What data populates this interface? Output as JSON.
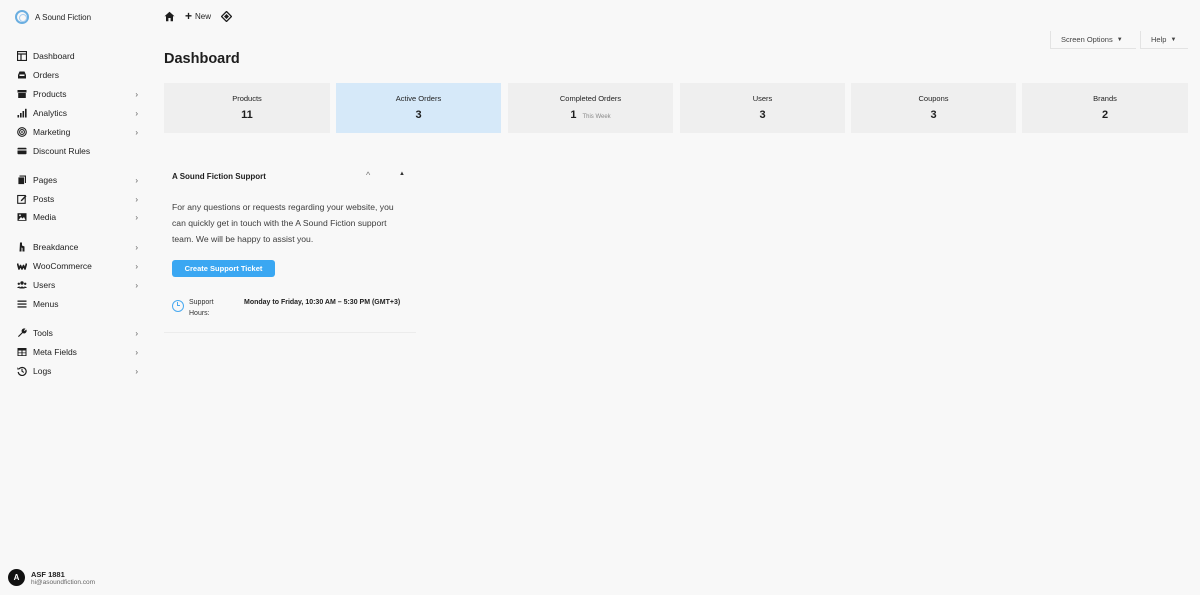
{
  "brand": {
    "name": "A Sound Fiction"
  },
  "sidebar": {
    "items": [
      {
        "label": "Dashboard",
        "icon": "dashboard-icon",
        "has_children": false
      },
      {
        "label": "Orders",
        "icon": "inbox-icon",
        "has_children": false
      },
      {
        "label": "Products",
        "icon": "archive-icon",
        "has_children": true
      },
      {
        "label": "Analytics",
        "icon": "bar-chart-icon",
        "has_children": true
      },
      {
        "label": "Marketing",
        "icon": "target-icon",
        "has_children": true
      },
      {
        "label": "Discount Rules",
        "icon": "credit-card-icon",
        "has_children": false
      },
      {
        "label": "Pages",
        "icon": "pages-icon",
        "has_children": true
      },
      {
        "label": "Posts",
        "icon": "edit-icon",
        "has_children": true
      },
      {
        "label": "Media",
        "icon": "image-icon",
        "has_children": true
      },
      {
        "label": "Breakdance",
        "icon": "breakdance-icon",
        "has_children": true
      },
      {
        "label": "WooCommerce",
        "icon": "woocommerce-icon",
        "has_children": true
      },
      {
        "label": "Users",
        "icon": "users-icon",
        "has_children": true
      },
      {
        "label": "Menus",
        "icon": "menu-icon",
        "has_children": false
      },
      {
        "label": "Tools",
        "icon": "wrench-icon",
        "has_children": true
      },
      {
        "label": "Meta Fields",
        "icon": "table-icon",
        "has_children": true
      },
      {
        "label": "Logs",
        "icon": "history-icon",
        "has_children": true
      }
    ],
    "chevron": "›"
  },
  "user": {
    "initial": "A",
    "name": "ASF 1881",
    "email": "hi@asoundfiction.com"
  },
  "topbar": {
    "new_label": "New",
    "plus": "+"
  },
  "screen_options": {
    "label": "Screen Options",
    "arrow": "▼"
  },
  "help": {
    "label": "Help",
    "arrow": "▼"
  },
  "page": {
    "title": "Dashboard"
  },
  "stats": [
    {
      "label": "Products",
      "value": "11",
      "sub": ""
    },
    {
      "label": "Active Orders",
      "value": "3",
      "sub": ""
    },
    {
      "label": "Completed Orders",
      "value": "1",
      "sub": "This Week"
    },
    {
      "label": "Users",
      "value": "3",
      "sub": ""
    },
    {
      "label": "Coupons",
      "value": "3",
      "sub": ""
    },
    {
      "label": "Brands",
      "value": "2",
      "sub": ""
    }
  ],
  "support": {
    "title": "A Sound Fiction Support",
    "collapse_glyph": "^",
    "move_glyph": "▲",
    "text": "For any questions or requests regarding your website, you can quickly get in touch with the A Sound Fiction support team. We will be happy to assist you.",
    "button": "Create Support Ticket",
    "hours_label": "Support Hours:",
    "hours_value": "Monday to Friday, 10:30 AM – 5:30 PM (GMT+3)"
  },
  "colors": {
    "accent": "#3aa7f2",
    "active_card": "#d6e9f9",
    "card": "#efefef"
  }
}
